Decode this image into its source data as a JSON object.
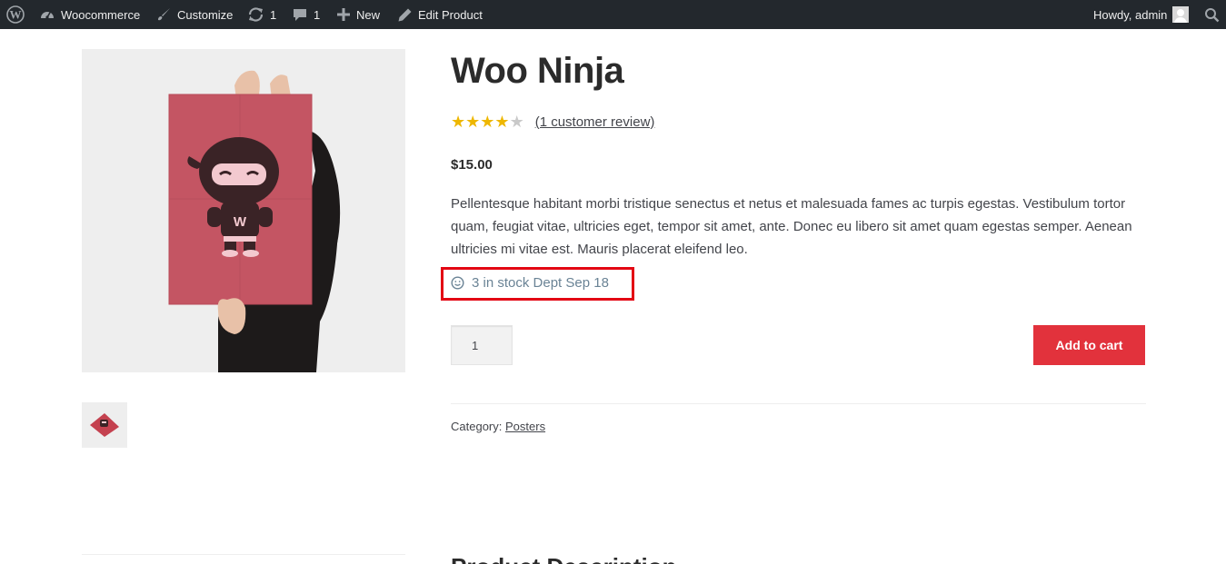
{
  "adminbar": {
    "site_name": "Woocommerce",
    "customize_label": "Customize",
    "updates_count": "1",
    "comments_count": "1",
    "new_label": "New",
    "edit_label": "Edit Product",
    "greeting": "Howdy, admin",
    "icons": [
      "wordpress-icon",
      "dashboard-icon",
      "brush-icon",
      "updates-icon",
      "comment-icon",
      "plus-icon",
      "pencil-icon",
      "avatar",
      "search-icon"
    ]
  },
  "product": {
    "title": "Woo Ninja",
    "rating_value": 4,
    "rating_max": 5,
    "review_link": "(1 customer review)",
    "price": "$15.00",
    "description": "Pellentesque habitant morbi tristique senectus et netus et malesuada fames ac turpis egestas. Vestibulum tortor quam, feugiat vitae, ultricies eget, tempor sit amet, ante. Donec eu libero sit amet quam egestas semper. Aenean ultricies mi vitae est. Mauris placerat eleifend leo.",
    "stock_text": "3 in stock Dept Sep 18",
    "quantity": "1",
    "add_to_cart_label": "Add to cart",
    "category_label": "Category:",
    "category_link": "Posters"
  },
  "gallery": {
    "poster_letter": "W"
  },
  "sections": {
    "description_heading": "Product Description"
  },
  "colors": {
    "adminbar_bg": "#23282d",
    "accent_button": "#e2323c",
    "highlight_border": "#e30613",
    "star": "#eeb700",
    "stock_text": "#6a8395",
    "poster": "#c45563"
  }
}
